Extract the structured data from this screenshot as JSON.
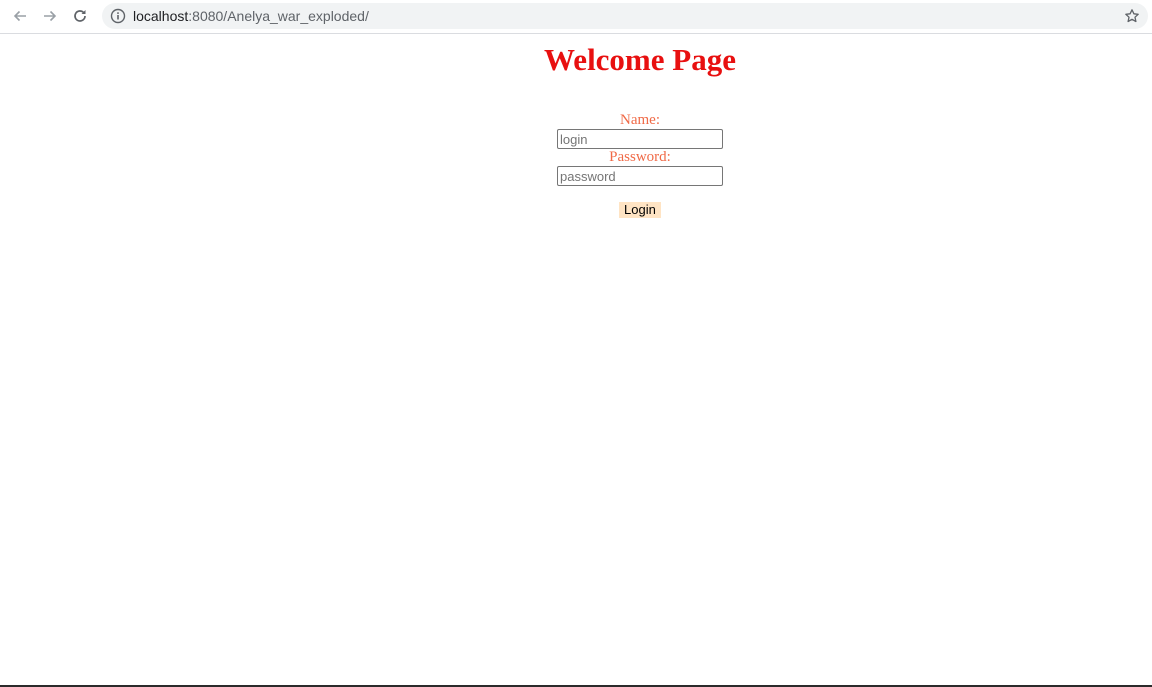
{
  "browser": {
    "url_host": "localhost",
    "url_rest": ":8080/Anelya_war_exploded/",
    "icons": {
      "back": "arrow-left-icon",
      "forward": "arrow-right-icon",
      "reload": "reload-icon",
      "info": "info-icon",
      "bookmark": "star-icon"
    }
  },
  "page": {
    "title": "Welcome Page",
    "form": {
      "name_label": "Name:",
      "name_placeholder": "login",
      "name_value": "",
      "password_label": "Password:",
      "password_placeholder": "password",
      "password_value": "",
      "submit_label": "Login"
    }
  },
  "colors": {
    "title": "#e81010",
    "labels": "#f06a47",
    "button_bg": "#ffe4c4"
  }
}
